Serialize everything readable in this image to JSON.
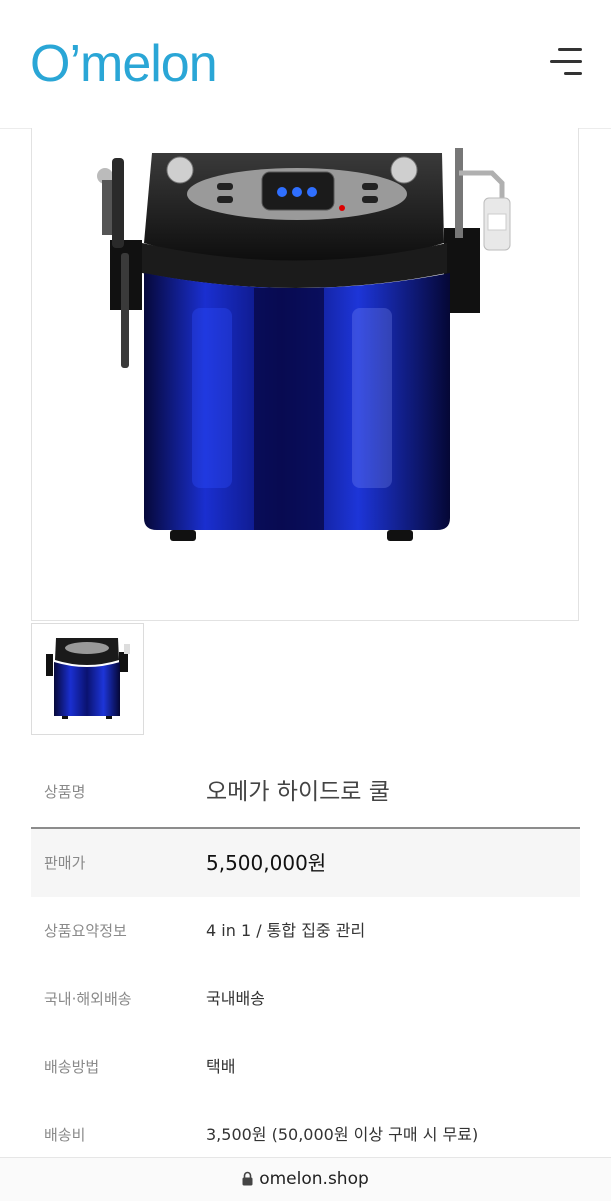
{
  "header": {
    "logo_text": "O’melon",
    "menu_icon": "hamburger-menu-icon"
  },
  "product": {
    "image_alt": "오메가 하이드로 쿨",
    "info": [
      {
        "label": "상품명",
        "value": "오메가 하이드로 쿨"
      },
      {
        "label": "판매가",
        "value": "5,500,000원"
      },
      {
        "label": "상품요약정보",
        "value": "4 in 1 / 통합 집중 관리"
      },
      {
        "label": "국내·해외배송",
        "value": "국내배송"
      },
      {
        "label": "배송방법",
        "value": "택배"
      },
      {
        "label": "배송비",
        "value": "3,500원 (50,000원 이상 구매 시 무료)"
      }
    ]
  },
  "browser": {
    "url": "omelon.shop",
    "lock_icon": "lock-icon"
  },
  "colors": {
    "brand": "#2aa6d6",
    "price_row_bg": "#f6f6f6",
    "machine_blue": "#1a2fd0"
  }
}
